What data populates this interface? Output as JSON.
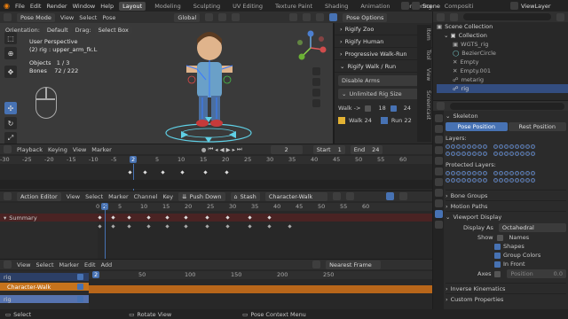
{
  "topbar": {
    "menus": [
      "File",
      "Edit",
      "Render",
      "Window",
      "Help"
    ],
    "tabs": [
      "Layout",
      "Modeling",
      "Sculpting",
      "UV Editing",
      "Texture Paint",
      "Shading",
      "Animation",
      "Rendering",
      "Compositi"
    ],
    "active_tab": "Layout",
    "scene_label": "Scene",
    "view_layer_label": "ViewLayer"
  },
  "viewport": {
    "mode": "Pose Mode",
    "menus": [
      "View",
      "Select",
      "Pose"
    ],
    "orientation_label": "Orientation:",
    "orientation_value": "Default",
    "drag_label": "Drag:",
    "drag_value": "Select Box",
    "transform": "Global",
    "pose_options": "Pose Options",
    "info_line1": "User Perspective",
    "info_line2": "(2) rig : upper_arm_fk.L",
    "objects_label": "Objects",
    "objects_value": "1 / 3",
    "bones_label": "Bones",
    "bones_value": "72 / 222"
  },
  "npanel": {
    "items": [
      "Rigify Zoo",
      "Rigify Human",
      "Progressive Walk-Run",
      "Rigify Walk / Run"
    ],
    "disable_arms": "Disable Arms",
    "unlimited": "Unlimited Rig Size",
    "walk_label": "Walk ->",
    "walk_a": "18",
    "walk_b": "24",
    "walk24": "Walk 24",
    "run22": "Run 22",
    "side_tabs": [
      "Item",
      "Tool",
      "View",
      "Screencast"
    ]
  },
  "outliner": {
    "root": "Scene Collection",
    "rows": [
      "Collection",
      "WGTS_rig",
      "BezierCircle",
      "Empty",
      "Empty.001",
      "metarig",
      "rig"
    ]
  },
  "props": {
    "skeleton": "Skeleton",
    "pose_position": "Pose Position",
    "rest_position": "Rest Position",
    "layers": "Layers:",
    "protected_layers": "Protected Layers:",
    "bone_groups": "Bone Groups",
    "motion_paths": "Motion Paths",
    "viewport_display": "Viewport Display",
    "display_as_label": "Display As",
    "display_as_value": "Octahedral",
    "show_label": "Show",
    "names": "Names",
    "shapes": "Shapes",
    "group_colors": "Group Colors",
    "in_front": "In Front",
    "axes": "Axes",
    "position_label": "Position",
    "position_value": "0.0",
    "inverse_kinematics": "Inverse Kinematics",
    "custom_properties": "Custom Properties"
  },
  "timeline": {
    "menus": [
      "Playback",
      "Keying",
      "View",
      "Marker"
    ],
    "current_frame": "2",
    "start_label": "Start",
    "start_value": "1",
    "end_label": "End",
    "end_value": "24",
    "ticks": [
      "-30",
      "-25",
      "-20",
      "-15",
      "-10",
      "-5",
      "0",
      "5",
      "10",
      "15",
      "20",
      "25",
      "30",
      "35",
      "40",
      "45",
      "50",
      "55",
      "60"
    ],
    "playhead": "2"
  },
  "dopesheet": {
    "mode": "Action Editor",
    "menus": [
      "View",
      "Select",
      "Marker",
      "Channel",
      "Key"
    ],
    "push_down": "Push Down",
    "stash": "Stash",
    "action": "Character-Walk",
    "ticks": [
      "0",
      "5",
      "10",
      "15",
      "20",
      "25",
      "30",
      "35",
      "40",
      "45",
      "50",
      "55",
      "60"
    ],
    "playhead": "2",
    "summary": "Summary"
  },
  "nla": {
    "menus": [
      "View",
      "Select",
      "Marker",
      "Edit",
      "Add"
    ],
    "filter": "Nearest Frame",
    "ticks": [
      "0",
      "50",
      "100",
      "150",
      "200",
      "250"
    ],
    "playhead": "2",
    "tracks": [
      "rig",
      "Character-Walk",
      "rig"
    ]
  },
  "status": {
    "items": [
      "Select",
      "Rotate View",
      "Pose Context Menu"
    ]
  },
  "colors": {
    "accent": "#4772b3",
    "strip": "#c6731c",
    "summary": "#4a2323"
  }
}
